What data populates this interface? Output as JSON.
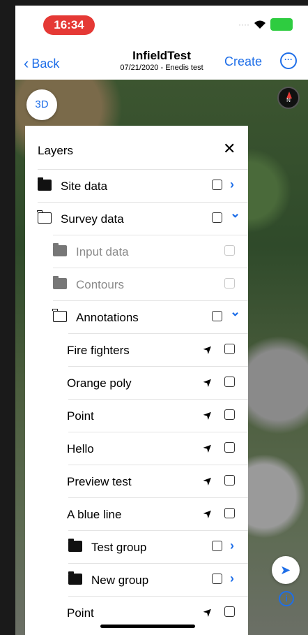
{
  "status": {
    "time": "16:34"
  },
  "nav": {
    "back_label": "Back",
    "title": "InfieldTest",
    "subtitle": "07/21/2020 - Enedis test",
    "create_label": "Create",
    "more_icon": "ellipsis-circle-icon"
  },
  "map": {
    "btn_3d": "3D",
    "compass_label": "N"
  },
  "layers": {
    "title": "Layers",
    "items": [
      {
        "label": "Site data",
        "level": 0,
        "icon": "folder-filled",
        "control": "chevron-right"
      },
      {
        "label": "Survey data",
        "level": 0,
        "icon": "folder-outline",
        "control": "chevron-down"
      },
      {
        "label": "Input data",
        "level": 1,
        "icon": "folder-grey",
        "control": "checkbox-muted"
      },
      {
        "label": "Contours",
        "level": 1,
        "icon": "folder-grey",
        "control": "checkbox-muted"
      },
      {
        "label": "Annotations",
        "level": 1,
        "icon": "folder-outline",
        "control": "chevron-down"
      },
      {
        "label": "Fire fighters",
        "level": 2,
        "icon": "",
        "control": "nav"
      },
      {
        "label": "Orange poly",
        "level": 2,
        "icon": "",
        "control": "nav"
      },
      {
        "label": "Point",
        "level": 2,
        "icon": "",
        "control": "nav"
      },
      {
        "label": "Hello",
        "level": 2,
        "icon": "",
        "control": "nav"
      },
      {
        "label": "Preview test",
        "level": 2,
        "icon": "",
        "control": "nav"
      },
      {
        "label": "A blue line",
        "level": 2,
        "icon": "",
        "control": "nav"
      },
      {
        "label": "Test group",
        "level": 2,
        "icon": "folder-filled",
        "control": "chevron-right"
      },
      {
        "label": "New group",
        "level": 2,
        "icon": "folder-filled",
        "control": "chevron-right"
      },
      {
        "label": "Point",
        "level": 2,
        "icon": "",
        "control": "nav"
      }
    ]
  }
}
